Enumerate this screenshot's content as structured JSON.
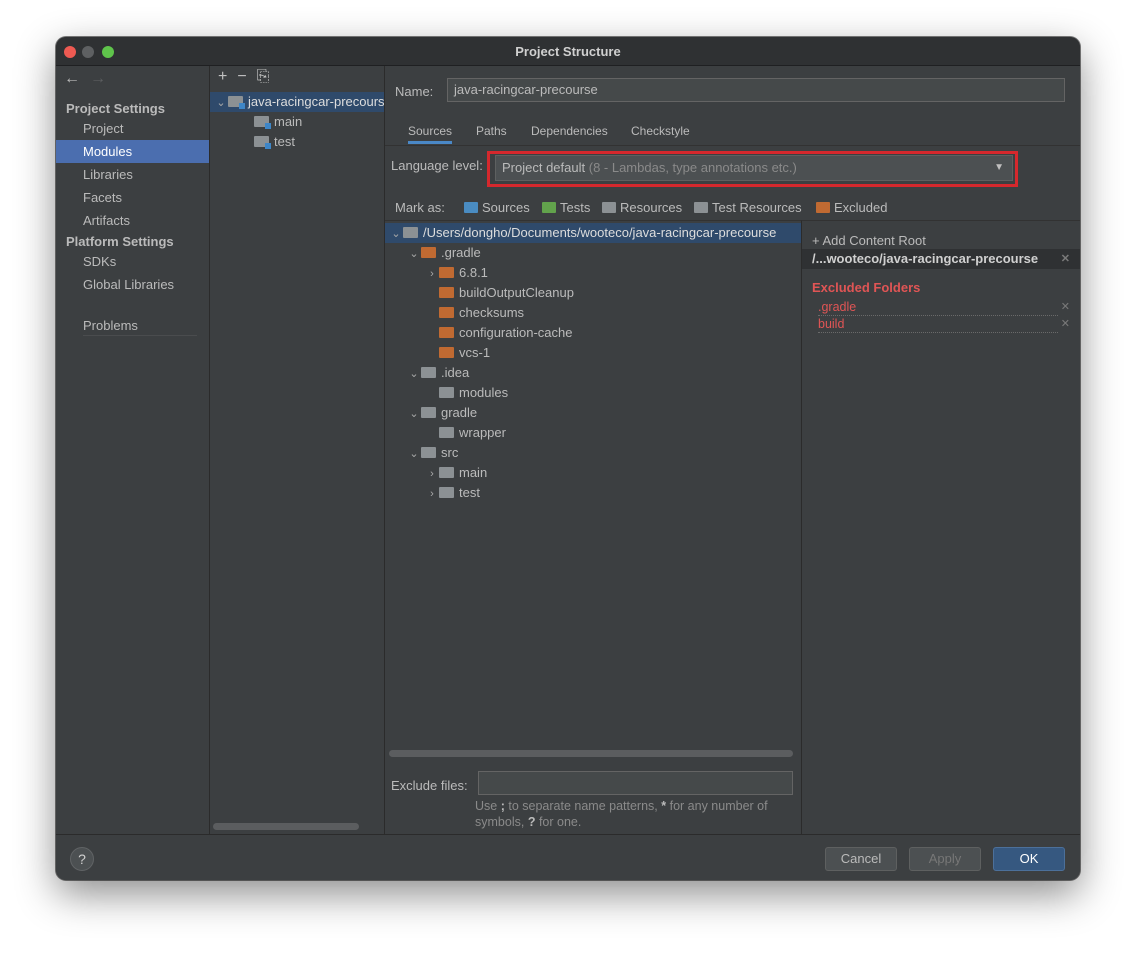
{
  "window": {
    "title": "Project Structure"
  },
  "sidebar": {
    "back": "←",
    "forward": "→",
    "project_settings_label": "Project Settings",
    "platform_settings_label": "Platform Settings",
    "items": [
      {
        "label": "Project"
      },
      {
        "label": "Modules"
      },
      {
        "label": "Libraries"
      },
      {
        "label": "Facets"
      },
      {
        "label": "Artifacts"
      },
      {
        "label": "SDKs"
      },
      {
        "label": "Global Libraries"
      },
      {
        "label": "Problems"
      }
    ],
    "selected": "Modules"
  },
  "modules": {
    "toolbar": {
      "add": "+",
      "remove": "−",
      "copy": "⎘"
    },
    "tree": [
      {
        "label": "java-racingcar-precourse"
      },
      {
        "label": "main"
      },
      {
        "label": "test"
      }
    ]
  },
  "main": {
    "name_label": "Name:",
    "name_value": "java-racingcar-precourse",
    "tabs": [
      "Sources",
      "Paths",
      "Dependencies",
      "Checkstyle"
    ],
    "active_tab": "Sources",
    "language_level_label": "Language level:",
    "language_level_value": "Project default",
    "language_level_hint": "(8 - Lambdas, type annotations etc.)",
    "mark_as_label": "Mark as:",
    "mark_as_buttons": [
      {
        "label": "Sources",
        "color": "#4a8cc2"
      },
      {
        "label": "Tests",
        "color": "#62a34c"
      },
      {
        "label": "Resources",
        "color": "#8c9194"
      },
      {
        "label": "Test Resources",
        "color": "#8c9194"
      },
      {
        "label": "Excluded",
        "color": "#c06a32"
      }
    ],
    "folder_tree": [
      {
        "label": "/Users/dongho/Documents/wooteco/java-racingcar-precourse"
      },
      {
        "label": ".gradle"
      },
      {
        "label": "6.8.1"
      },
      {
        "label": "buildOutputCleanup"
      },
      {
        "label": "checksums"
      },
      {
        "label": "configuration-cache"
      },
      {
        "label": "vcs-1"
      },
      {
        "label": ".idea"
      },
      {
        "label": "modules"
      },
      {
        "label": "gradle"
      },
      {
        "label": "wrapper"
      },
      {
        "label": "src"
      },
      {
        "label": "main"
      },
      {
        "label": "test"
      }
    ],
    "exclude_files_label": "Exclude files:",
    "exclude_files_value": "",
    "exclude_hint_1": "Use",
    "exclude_hint_sym1": ";",
    "exclude_hint_2": "to separate name patterns,",
    "exclude_hint_sym2": "*",
    "exclude_hint_3": "for any number of symbols,",
    "exclude_hint_sym3": "?",
    "exclude_hint_4": "for one."
  },
  "content_root": {
    "add_label": "Add Content Root",
    "root_path": "/...wooteco/java-racingcar-precourse",
    "excluded_heading": "Excluded Folders",
    "excluded": [
      ".gradle",
      "build"
    ],
    "remove_icon": "✕"
  },
  "footer": {
    "help": "?",
    "cancel": "Cancel",
    "apply": "Apply",
    "ok": "OK"
  },
  "colors": {
    "accent": "#4b6eaf",
    "highlight_border": "#d5282d",
    "excluded": "#e05555"
  }
}
